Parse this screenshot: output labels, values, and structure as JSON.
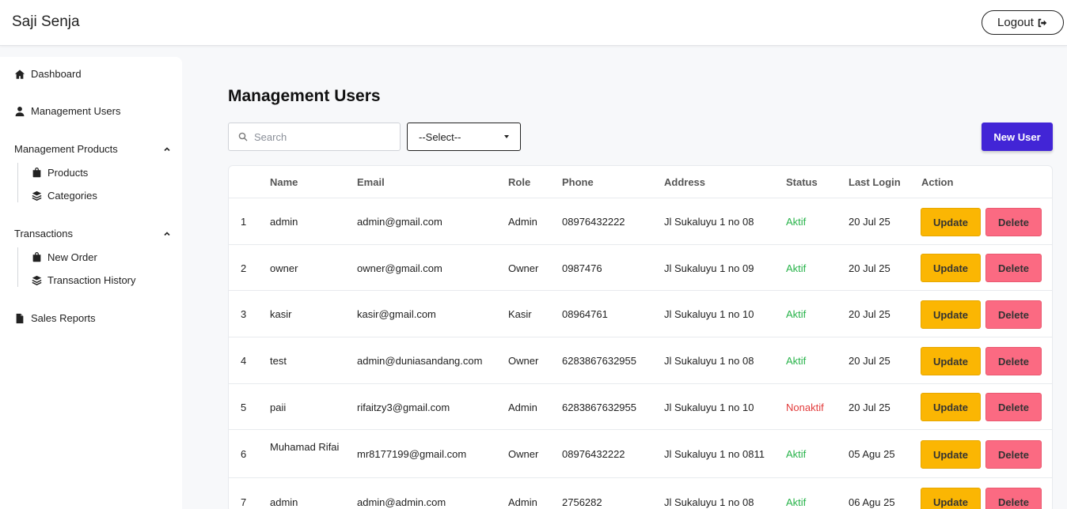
{
  "app": {
    "brand": "Saji Senja",
    "logout_label": "Logout"
  },
  "sidebar": {
    "dashboard": "Dashboard",
    "management_users": "Management Users",
    "management_products": "Management Products",
    "products": "Products",
    "categories": "Categories",
    "transactions": "Transactions",
    "new_order": "New Order",
    "transaction_history": "Transaction History",
    "sales_reports": "Sales Reports"
  },
  "page": {
    "title": "Management Users"
  },
  "toolbar": {
    "search_placeholder": "Search",
    "select_value": "--Select--",
    "new_user_label": "New User"
  },
  "table": {
    "headers": [
      "Name",
      "Email",
      "Role",
      "Phone",
      "Address",
      "Status",
      "Last Login",
      "Action"
    ],
    "update_label": "Update",
    "delete_label": "Delete",
    "rows": [
      {
        "no": "1",
        "name": "admin",
        "email": "admin@gmail.com",
        "role": "Admin",
        "phone": "08976432222",
        "address": "Jl Sukaluyu 1 no 08",
        "status": "Aktif",
        "last_login": "20 Jul 25"
      },
      {
        "no": "2",
        "name": "owner",
        "email": "owner@gmail.com",
        "role": "Owner",
        "phone": "0987476",
        "address": "Jl Sukaluyu 1 no 09",
        "status": "Aktif",
        "last_login": "20 Jul 25"
      },
      {
        "no": "3",
        "name": "kasir",
        "email": "kasir@gmail.com",
        "role": "Kasir",
        "phone": "08964761",
        "address": "Jl Sukaluyu 1 no 10",
        "status": "Aktif",
        "last_login": "20 Jul 25"
      },
      {
        "no": "4",
        "name": "test",
        "email": "admin@duniasandang.com",
        "role": "Owner",
        "phone": "6283867632955",
        "address": "Jl Sukaluyu 1 no 08",
        "status": "Aktif",
        "last_login": "20 Jul 25"
      },
      {
        "no": "5",
        "name": "paii",
        "email": "rifaitzy3@gmail.com",
        "role": "Admin",
        "phone": "6283867632955",
        "address": "Jl Sukaluyu 1 no 10",
        "status": "Nonaktif",
        "last_login": "20 Jul 25"
      },
      {
        "no": "6",
        "name": "Muhamad Rifai",
        "email": "mr8177199@gmail.com",
        "role": "Owner",
        "phone": "08976432222",
        "address": "Jl Sukaluyu 1 no 0811",
        "status": "Aktif",
        "last_login": "05 Agu 25"
      },
      {
        "no": "7",
        "name": "admin",
        "email": "admin@admin.com",
        "role": "Admin",
        "phone": "2756282",
        "address": "Jl Sukaluyu 1 no 08",
        "status": "Aktif",
        "last_login": "06 Agu 25"
      }
    ]
  },
  "colors": {
    "primary": "#4225d6",
    "update": "#fbb603",
    "delete": "#fb6a82",
    "aktif": "#28b34a",
    "nonaktif": "#e23b3b"
  },
  "icons": {
    "dashboard": "home-icon",
    "users": "user-icon",
    "products": "bag-icon",
    "categories": "layers-icon",
    "reports": "file-icon",
    "logout": "logout-icon",
    "search": "search-icon",
    "collapse": "chevron-up-icon"
  }
}
